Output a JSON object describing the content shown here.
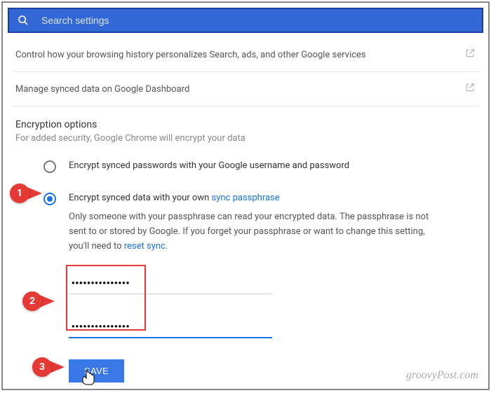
{
  "search": {
    "placeholder": "Search settings"
  },
  "rows": {
    "history": "Control how your browsing history personalizes Search, ads, and other Google services",
    "dashboard": "Manage synced data on Google Dashboard"
  },
  "encryption": {
    "title": "Encryption options",
    "sub": "For added security, Google Chrome will encrypt your data",
    "option1": "Encrypt synced passwords with your Google username and password",
    "option2_prefix": "Encrypt synced data with your own ",
    "option2_link": "sync passphrase",
    "desc_part1": "Only someone with your passphrase can read your encrypted data. The passphrase is not sent to or stored by Google. If you forget your passphrase or want to change this setting, you'll need to ",
    "desc_link": "reset sync",
    "desc_part2": "."
  },
  "passwords": {
    "pw1": "•••••••••••••••",
    "pw2": "•••••••••••••••"
  },
  "save_label": "SAVE",
  "callouts": {
    "one": "1",
    "two": "2",
    "three": "3"
  },
  "watermark": "groovyPost.com"
}
